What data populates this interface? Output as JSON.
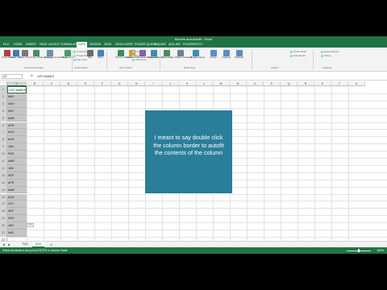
{
  "window": {
    "title": "Months and Autofit - Excel"
  },
  "tabs": [
    "FILE",
    "HOME",
    "INSERT",
    "PAGE LAYOUT",
    "FORMULAS",
    "DATA",
    "REVIEW",
    "VIEW",
    "DEVELOPER",
    "POWER QUERY",
    "INQUIRE",
    "ADD-INS",
    "POWERPIVOT"
  ],
  "active_tab": "DATA",
  "ribbon": {
    "buttons": [
      "From Access",
      "From Web",
      "From Text",
      "From Other Sources",
      "Existing Connections",
      "Refresh All",
      "Sort",
      "Filter",
      "Text to Columns",
      "Flash Fill",
      "Remove Duplicates",
      "Data Validation",
      "Consolidate",
      "What-If Analysis",
      "Relationships",
      "Group",
      "Ungroup",
      "Subtotal"
    ],
    "small": [
      "Connections",
      "Properties",
      "Edit Links",
      "Clear",
      "Reapply",
      "Advanced",
      "Show Detail",
      "Hide Detail",
      "Data Analysis",
      "Solver"
    ],
    "groups": [
      "Get External Data",
      "Connections",
      "Sort & Filter",
      "Data Tools",
      "Outline",
      "Analysis"
    ]
  },
  "formula_bar": {
    "name_box": "A1",
    "fx": "fx",
    "value": "LIST MAKES"
  },
  "columns": [
    "A",
    "B",
    "C",
    "D",
    "E",
    "F",
    "G",
    "H",
    "I",
    "J",
    "K",
    "L",
    "M",
    "N",
    "O",
    "P",
    "Q",
    "R",
    "S",
    "T",
    "U"
  ],
  "rows": [
    "1",
    "2",
    "3",
    "4",
    "5",
    "6",
    "7",
    "8",
    "9",
    "10",
    "11",
    "12",
    "13",
    "14",
    "15",
    "16",
    "17",
    "18",
    "19",
    "20",
    "21",
    "22"
  ],
  "cells_A": [
    "LIST MAKES",
    "MAY",
    "NOV",
    "DEC",
    "MAR",
    "APR",
    "AUG",
    "AUG",
    "JAN",
    "FEB",
    "MAR",
    "JAN",
    "SEP",
    "APR",
    "MAR",
    "AUG",
    "OCT",
    "SEP",
    "NOV",
    "JAN",
    "MAY",
    ""
  ],
  "paste_icon": "Ctrl",
  "note": [
    "I meant to say double click",
    "the column border to autofit",
    "the contents of the column"
  ],
  "sheets": [
    "FAS",
    "BAS"
  ],
  "active_sheet": "BAS",
  "status": {
    "left": "Select destination and press ENTER or choose Paste",
    "zoom": "100%"
  },
  "colors": {
    "accent": "#217346",
    "note_bg": "#2b7e9a"
  }
}
